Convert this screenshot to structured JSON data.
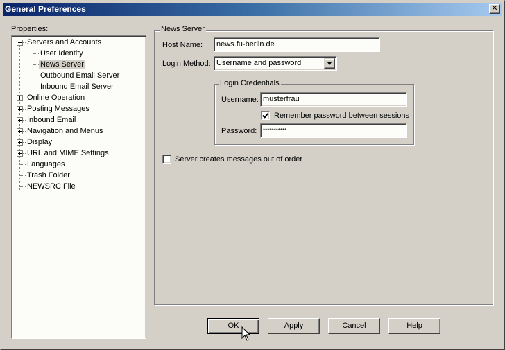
{
  "window": {
    "title": "General Preferences",
    "close_icon": "close-x-icon"
  },
  "sidebar": {
    "label": "Properties:",
    "items": [
      {
        "label": "Servers and Accounts",
        "level": 0,
        "expander": "minus"
      },
      {
        "label": "User Identity",
        "level": 1
      },
      {
        "label": "News Server",
        "level": 1,
        "selected": true
      },
      {
        "label": "Outbound Email Server",
        "level": 1
      },
      {
        "label": "Inbound Email Server",
        "level": 1
      },
      {
        "label": "Online Operation",
        "level": 0,
        "expander": "plus"
      },
      {
        "label": "Posting Messages",
        "level": 0,
        "expander": "plus"
      },
      {
        "label": "Inbound Email",
        "level": 0,
        "expander": "plus"
      },
      {
        "label": "Navigation and Menus",
        "level": 0,
        "expander": "plus"
      },
      {
        "label": "Display",
        "level": 0,
        "expander": "plus"
      },
      {
        "label": "URL and MIME Settings",
        "level": 0,
        "expander": "plus"
      },
      {
        "label": "Languages",
        "level": 0
      },
      {
        "label": "Trash Folder",
        "level": 0
      },
      {
        "label": "NEWSRC File",
        "level": 0
      }
    ]
  },
  "news_server": {
    "group_title": "News Server",
    "host_name_label": "Host Name:",
    "host_name_value": "news.fu-berlin.de",
    "login_method_label": "Login Method:",
    "login_method_value": "Username and password",
    "credentials": {
      "group_title": "Login Credentials",
      "username_label": "Username:",
      "username_value": "musterfrau",
      "remember_label": "Remember password between sessions",
      "remember_checked": true,
      "password_label": "Password:",
      "password_value": "***********"
    },
    "out_of_order_label": "Server creates messages out of order",
    "out_of_order_checked": false
  },
  "buttons": {
    "ok": "OK",
    "apply": "Apply",
    "cancel": "Cancel",
    "help": "Help"
  }
}
